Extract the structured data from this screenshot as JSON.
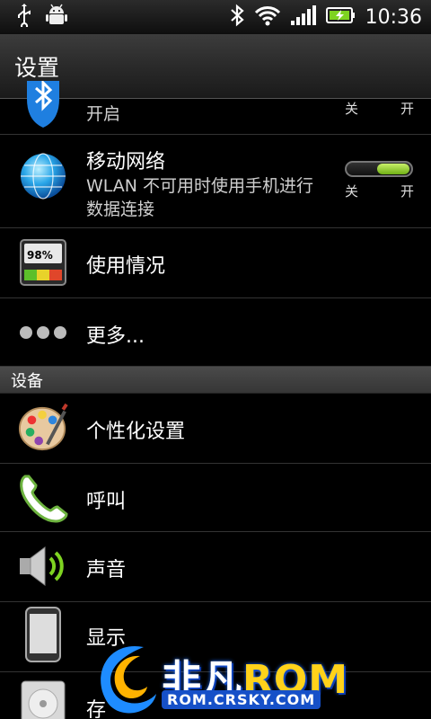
{
  "status_bar": {
    "time": "10:36",
    "icons": [
      "usb-icon",
      "android-debug-icon",
      "bluetooth-icon",
      "wifi-icon",
      "signal-icon",
      "battery-charging-icon"
    ]
  },
  "header": {
    "title": "设置"
  },
  "rows_top": [
    {
      "id": "bluetooth",
      "icon": "bluetooth-icon",
      "sub": "开启",
      "toggle_off": "关",
      "toggle_on": "开"
    },
    {
      "id": "mobile-network",
      "icon": "globe-network-icon",
      "title": "移动网络",
      "sub_line1": "WLAN 不可用时使用手机进行",
      "sub_line2": "数据连接",
      "toggle_off": "关",
      "toggle_on": "开",
      "toggle_state": "on"
    },
    {
      "id": "usage",
      "icon": "usage-meter-icon",
      "title": "使用情况",
      "meter_text": "98%"
    },
    {
      "id": "more",
      "icon": "more-dots-icon",
      "title": "更多..."
    }
  ],
  "section_device": {
    "label": "设备"
  },
  "rows_device": [
    {
      "id": "personalize",
      "icon": "palette-icon",
      "title": "个性化设置"
    },
    {
      "id": "call",
      "icon": "phone-handset-icon",
      "title": "呼叫"
    },
    {
      "id": "sound",
      "icon": "speaker-icon",
      "title": "声音"
    },
    {
      "id": "display",
      "icon": "phone-display-icon",
      "title": "显示"
    },
    {
      "id": "storage",
      "icon": "storage-icon",
      "title": "存"
    }
  ],
  "watermark": {
    "name_cn": "非凡",
    "name_en": "ROM",
    "url": "ROM.CRSKY.COM"
  },
  "colors": {
    "toggle_on": "#8cd030",
    "section_bg": "#3f3f3f",
    "divider": "#333333"
  }
}
